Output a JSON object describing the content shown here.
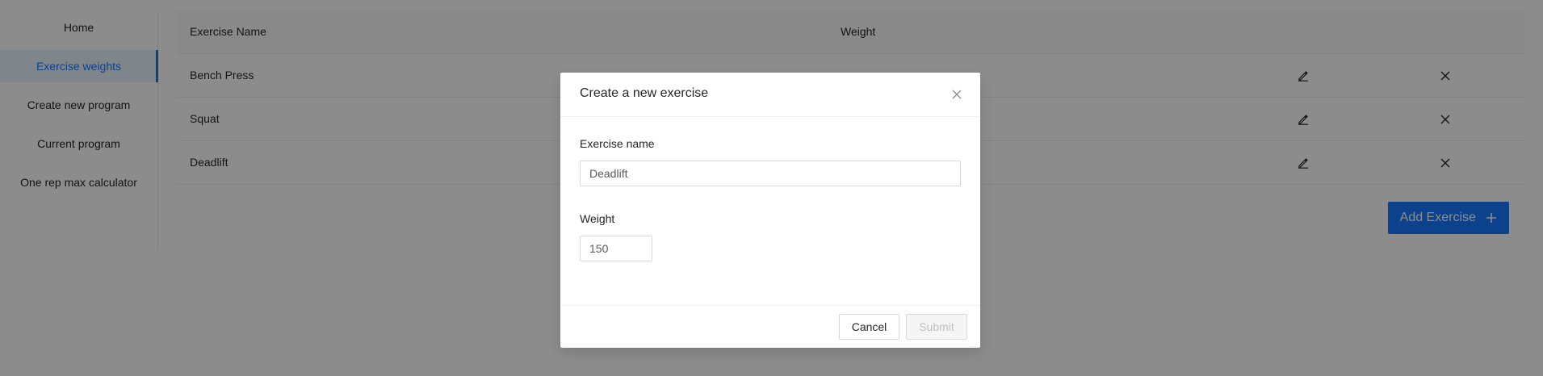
{
  "sidebar": {
    "items": [
      {
        "label": "Home"
      },
      {
        "label": "Exercise weights"
      },
      {
        "label": "Create new program"
      },
      {
        "label": "Current program"
      },
      {
        "label": "One rep max calculator"
      }
    ],
    "active_index": 1
  },
  "table": {
    "columns": [
      "Exercise Name",
      "Weight"
    ],
    "rows": [
      {
        "name": "Bench Press"
      },
      {
        "name": "Squat"
      },
      {
        "name": "Deadlift"
      }
    ]
  },
  "add_button": {
    "label": "Add Exercise",
    "icon": "plus-icon"
  },
  "modal": {
    "title": "Create a new exercise",
    "fields": {
      "exercise_name": {
        "label": "Exercise name",
        "value": "Deadlift"
      },
      "weight": {
        "label": "Weight",
        "value": "150"
      }
    },
    "cancel_label": "Cancel",
    "submit_label": "Submit"
  },
  "colors": {
    "accent": "#1677ff",
    "overlay": "rgba(0,0,0,0.45)"
  }
}
